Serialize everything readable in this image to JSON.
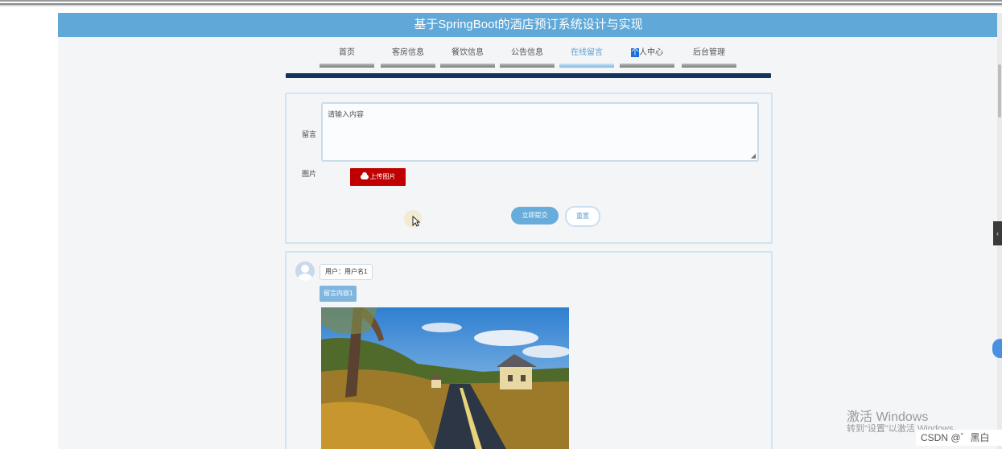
{
  "app": {
    "title": "基于SpringBoot的酒店预订系统设计与实现"
  },
  "nav": {
    "items": [
      {
        "label": "首页"
      },
      {
        "label": "客房信息"
      },
      {
        "label": "餐饮信息"
      },
      {
        "label": "公告信息"
      },
      {
        "label": "在线留言"
      },
      {
        "label_highlight": "个",
        "label_rest": "人中心"
      },
      {
        "label": "后台管理"
      }
    ],
    "active_index": 4
  },
  "form": {
    "message_label": "留言",
    "message_placeholder": "请输入内容",
    "image_label": "图片",
    "upload_label": "上传图片",
    "submit_label": "立即提交",
    "reset_label": "重置"
  },
  "messages": [
    {
      "user": "用户：用户名1",
      "content": "留言内容1"
    }
  ],
  "overlay": {
    "windows_line1": "激活 Windows",
    "windows_line2": "转到\"设置\"以激活 Windows。",
    "csdn": "CSDN @゛黑白"
  },
  "colors": {
    "title_bar": "#5fa8d8",
    "nav_underline": "#14345e",
    "upload_button": "#c00000",
    "submit_button": "#67acdb"
  }
}
